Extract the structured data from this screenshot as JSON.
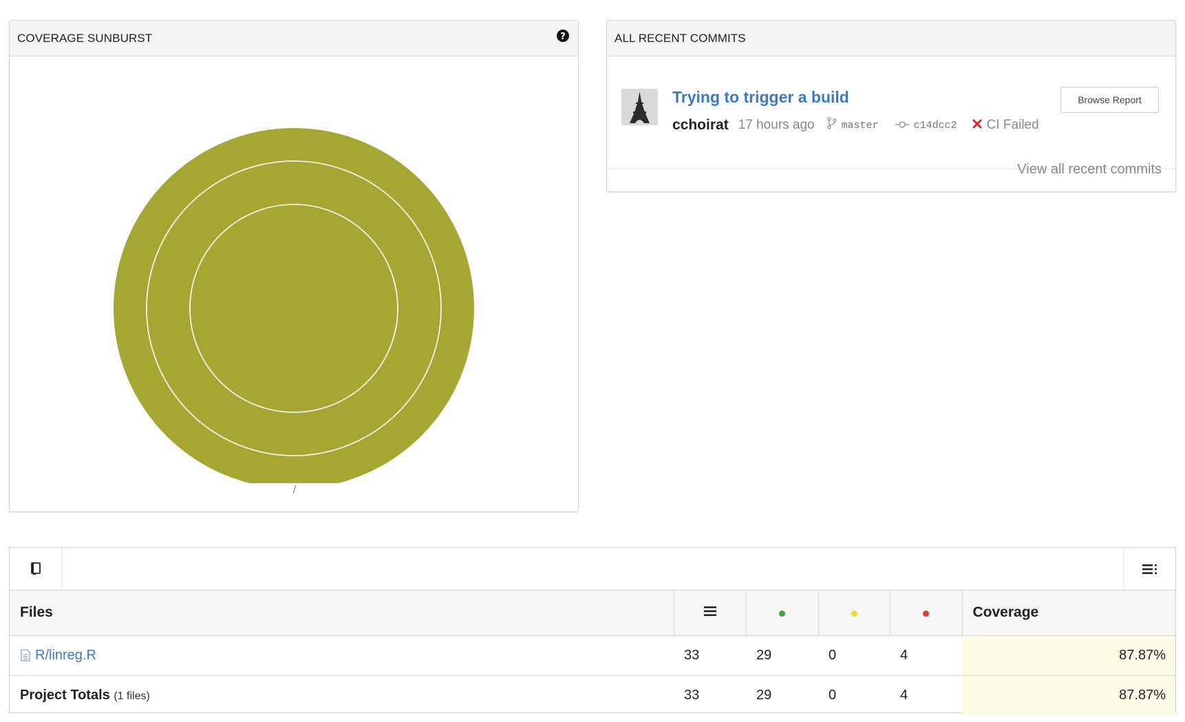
{
  "sunburst": {
    "title": "COVERAGE SUNBURST",
    "help_icon": "question-circle-icon",
    "root_label": "/",
    "color": "#a6a632"
  },
  "commits": {
    "title": "ALL RECENT COMMITS",
    "commit_title": "Trying to trigger a build",
    "author": "cchoirat",
    "time": "17 hours ago",
    "branch": "master",
    "sha": "c14dcc2",
    "ci_status": "CI Failed",
    "browse_label": "Browse Report",
    "view_all": "View all recent commits",
    "link_color": "#3a7abf",
    "fail_color": "#e0242a"
  },
  "files": {
    "toolbar_left_icon": "book-icon",
    "toolbar_right_icon": "list-options-icon",
    "headers": {
      "files": "Files",
      "lines_icon": "lines-icon",
      "hits_color": "#3fa33f",
      "partial_color": "#f2d833",
      "misses_color": "#e23b3b",
      "coverage": "Coverage"
    },
    "rows": [
      {
        "name": "R/linreg.R",
        "lines": "33",
        "hits": "29",
        "partials": "0",
        "misses": "4",
        "coverage": "87.87%"
      }
    ],
    "totals": {
      "label": "Project Totals",
      "count": "(1 files)",
      "lines": "33",
      "hits": "29",
      "partials": "0",
      "misses": "4",
      "coverage": "87.87%"
    }
  }
}
